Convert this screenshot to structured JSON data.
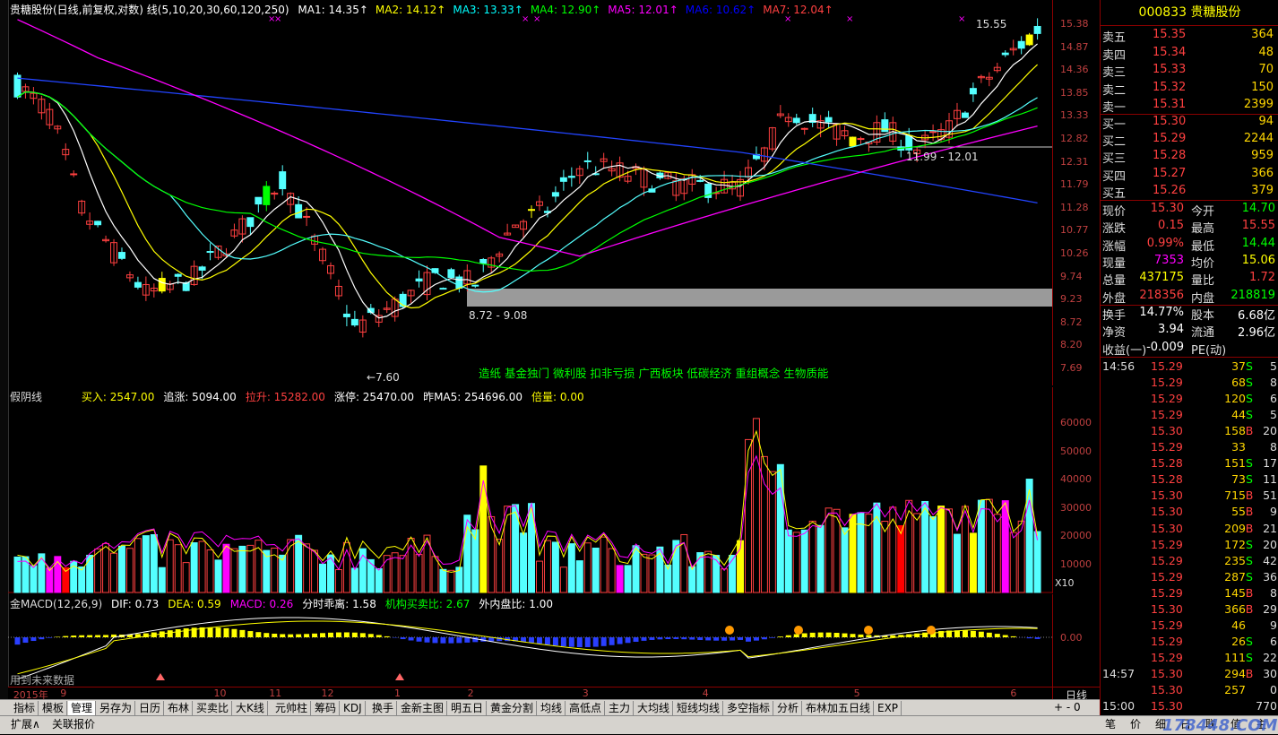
{
  "main_header": {
    "title": "贵糖股份(日线,前复权,对数) 线(5,10,20,30,60,120,250)",
    "ma": [
      {
        "label": "MA1: 14.35",
        "color": "#ffffff"
      },
      {
        "label": "MA2: 14.12",
        "color": "#ffff00"
      },
      {
        "label": "MA3: 13.33",
        "color": "#00ffff"
      },
      {
        "label": "MA4: 12.90",
        "color": "#00ff00"
      },
      {
        "label": "MA5: 12.01",
        "color": "#ff00ff"
      },
      {
        "label": "MA6: 10.62",
        "color": "#0000ff"
      },
      {
        "label": "MA7: 12.04",
        "color": "#ff4040"
      }
    ]
  },
  "main_axis_labels": [
    "15.38",
    "14.87",
    "14.36",
    "13.85",
    "13.33",
    "12.82",
    "12.31",
    "11.79",
    "11.28",
    "10.77",
    "10.26",
    "9.74",
    "9.23",
    "8.72",
    "8.20",
    "7.69"
  ],
  "annotations": {
    "high": "15.55",
    "low": "7.60",
    "range1": "8.72 - 9.08",
    "range2": "11.99 - 12.01",
    "concepts": "造纸 基金独门 微利股 扣非亏损 广西板块 低碳经济 重组概念 生物质能"
  },
  "vol_header": {
    "name": "假阴线",
    "items": [
      {
        "label": "买入: 2547.00",
        "color": "#ffff00"
      },
      {
        "label": "追涨: 5094.00",
        "color": "#ffffff"
      },
      {
        "label": "拉升: 15282.00",
        "color": "#ff4040"
      },
      {
        "label": "涨停: 25470.00",
        "color": "#ffffff"
      },
      {
        "label": "昨MA5: 254696.00",
        "color": "#ffffff"
      },
      {
        "label": "倍量: 0.00",
        "color": "#ffff00"
      }
    ]
  },
  "vol_axis_labels": [
    "60000",
    "50000",
    "40000",
    "30000",
    "20000",
    "10000"
  ],
  "vol_unit": "X10",
  "macd_header": {
    "name": "金MACD(12,26,9)",
    "items": [
      {
        "label": "DIF: 0.73",
        "color": "#ffffff"
      },
      {
        "label": "DEA: 0.59",
        "color": "#ffff00"
      },
      {
        "label": "MACD: 0.26",
        "color": "#ff00ff"
      },
      {
        "label": "分时乖离: 1.58",
        "color": "#ffffff"
      },
      {
        "label": "机构买卖比: 2.67",
        "color": "#00ff00"
      },
      {
        "label": "外内盘比: 1.00",
        "color": "#ffffff"
      }
    ]
  },
  "macd_axis_label": "0.00",
  "macd_footnote": "用到未来数据",
  "dates": [
    {
      "label": "2015年",
      "pos": 0.005
    },
    {
      "label": "9",
      "pos": 0.05
    },
    {
      "label": "10",
      "pos": 0.197
    },
    {
      "label": "11",
      "pos": 0.25
    },
    {
      "label": "12",
      "pos": 0.3
    },
    {
      "label": "1",
      "pos": 0.37
    },
    {
      "label": "2",
      "pos": 0.44
    },
    {
      "label": "3",
      "pos": 0.55
    },
    {
      "label": "4",
      "pos": 0.665
    },
    {
      "label": "5",
      "pos": 0.81
    },
    {
      "label": "6",
      "pos": 0.96
    }
  ],
  "period_label": "日线",
  "quote": {
    "code": "000833",
    "name": "贵糖股份",
    "asks": [
      {
        "label": "卖五",
        "price": "15.35",
        "vol": "364"
      },
      {
        "label": "卖四",
        "price": "15.34",
        "vol": "48"
      },
      {
        "label": "卖三",
        "price": "15.33",
        "vol": "70"
      },
      {
        "label": "卖二",
        "price": "15.32",
        "vol": "150"
      },
      {
        "label": "卖一",
        "price": "15.31",
        "vol": "2399"
      }
    ],
    "bids": [
      {
        "label": "买一",
        "price": "15.30",
        "vol": "94"
      },
      {
        "label": "买二",
        "price": "15.29",
        "vol": "2244"
      },
      {
        "label": "买三",
        "price": "15.28",
        "vol": "959"
      },
      {
        "label": "买四",
        "price": "15.27",
        "vol": "366"
      },
      {
        "label": "买五",
        "price": "15.26",
        "vol": "379"
      }
    ],
    "stats": [
      {
        "l1": "现价",
        "v1": "15.30",
        "c1": "#ff4040",
        "l2": "今开",
        "v2": "14.70",
        "c2": "#00ff00"
      },
      {
        "l1": "涨跌",
        "v1": "0.15",
        "c1": "#ff4040",
        "l2": "最高",
        "v2": "15.55",
        "c2": "#ff4040"
      },
      {
        "l1": "涨幅",
        "v1": "0.99%",
        "c1": "#ff4040",
        "l2": "最低",
        "v2": "14.44",
        "c2": "#00ff00"
      },
      {
        "l1": "现量",
        "v1": "7353",
        "c1": "#ff00ff",
        "l2": "均价",
        "v2": "15.06",
        "c2": "#ffff00"
      },
      {
        "l1": "总量",
        "v1": "437175",
        "c1": "#ffff00",
        "l2": "量比",
        "v2": "1.72",
        "c2": "#ff4040"
      },
      {
        "l1": "外盘",
        "v1": "218356",
        "c1": "#ff4040",
        "l2": "内盘",
        "v2": "218819",
        "c2": "#00ff00"
      }
    ],
    "stats2": [
      {
        "l1": "换手",
        "v1": "14.77%",
        "l2": "股本",
        "v2": "6.68亿"
      },
      {
        "l1": "净资",
        "v1": "3.94",
        "l2": "流通",
        "v2": "2.96亿"
      },
      {
        "l1": "收益(一)",
        "v1": "-0.009",
        "l2": "PE(动)",
        "v2": ""
      }
    ],
    "ticks": [
      {
        "t": "14:56",
        "p": "15.29",
        "v": "37",
        "d": "S",
        "n": "5"
      },
      {
        "t": "",
        "p": "15.29",
        "v": "68",
        "d": "S",
        "n": "8"
      },
      {
        "t": "",
        "p": "15.29",
        "v": "120",
        "d": "S",
        "n": "6"
      },
      {
        "t": "",
        "p": "15.29",
        "v": "44",
        "d": "S",
        "n": "5"
      },
      {
        "t": "",
        "p": "15.30",
        "v": "158",
        "d": "B",
        "n": "20"
      },
      {
        "t": "",
        "p": "15.29",
        "v": "33",
        "d": "",
        "n": "8"
      },
      {
        "t": "",
        "p": "15.28",
        "v": "151",
        "d": "S",
        "n": "17"
      },
      {
        "t": "",
        "p": "15.28",
        "v": "73",
        "d": "S",
        "n": "11"
      },
      {
        "t": "",
        "p": "15.30",
        "v": "715",
        "d": "B",
        "n": "51"
      },
      {
        "t": "",
        "p": "15.30",
        "v": "55",
        "d": "B",
        "n": "9"
      },
      {
        "t": "",
        "p": "15.30",
        "v": "209",
        "d": "B",
        "n": "21"
      },
      {
        "t": "",
        "p": "15.29",
        "v": "172",
        "d": "S",
        "n": "20"
      },
      {
        "t": "",
        "p": "15.29",
        "v": "235",
        "d": "S",
        "n": "42"
      },
      {
        "t": "",
        "p": "15.29",
        "v": "287",
        "d": "S",
        "n": "36"
      },
      {
        "t": "",
        "p": "15.29",
        "v": "145",
        "d": "B",
        "n": "8"
      },
      {
        "t": "",
        "p": "15.30",
        "v": "366",
        "d": "B",
        "n": "29"
      },
      {
        "t": "",
        "p": "15.29",
        "v": "46",
        "d": "",
        "n": "9"
      },
      {
        "t": "",
        "p": "15.29",
        "v": "26",
        "d": "S",
        "n": "6"
      },
      {
        "t": "",
        "p": "15.29",
        "v": "111",
        "d": "S",
        "n": "22"
      },
      {
        "t": "14:57",
        "p": "15.30",
        "v": "294",
        "d": "B",
        "n": "30"
      },
      {
        "t": "",
        "p": "15.30",
        "v": "257",
        "d": "",
        "n": "0"
      },
      {
        "t": "15:00",
        "p": "15.30",
        "v": "",
        "d": "",
        "n": "770"
      }
    ]
  },
  "tabs": [
    "指标",
    "模板",
    "管理",
    "另存为",
    "日历",
    "布林",
    "买卖比",
    "大K线",
    "元帅柱",
    "筹码",
    "KDJ",
    "换手",
    "金新主图",
    "明五日",
    "黄金分割",
    "均线",
    "高低点",
    "主力",
    "大均线",
    "短线均线",
    "多空指标",
    "分析",
    "布林加五日线",
    "EXP"
  ],
  "active_tab": 2,
  "bottom_tabs": [
    "扩展∧",
    "关联报价"
  ],
  "quote_tabs": [
    "笔",
    "价",
    "细",
    "日",
    "联",
    "值",
    "主"
  ],
  "watermark": "178448.COM",
  "colors": {
    "up": "#ff4040",
    "down": "#54ffff",
    "bg": "#000000",
    "accent_yellow": "#ffff00"
  }
}
